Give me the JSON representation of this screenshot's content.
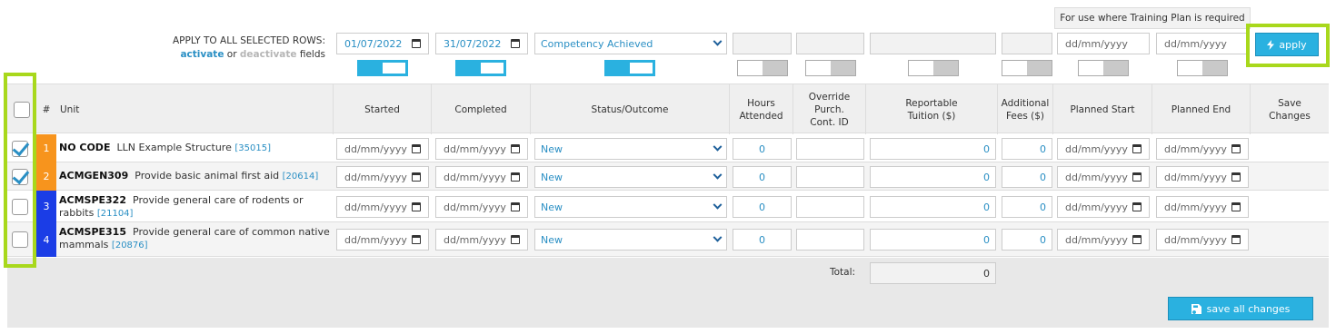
{
  "apply_bar": {
    "instruction": "APPLY TO ALL SELECTED ROWS:",
    "activate": "activate",
    "or": "or",
    "deactivate": "deactivate",
    "fields": "fields",
    "started": "01/07/2022",
    "completed": "31/07/2022",
    "status": "Competency Achieved",
    "planned_start_placeholder": "dd/mm/yyyy",
    "planned_end_placeholder": "dd/mm/yyyy",
    "training_plan_note": "For use where Training Plan is required",
    "apply_label": "apply"
  },
  "columns": {
    "num": "#",
    "unit": "Unit",
    "started": "Started",
    "completed": "Completed",
    "status": "Status/Outcome",
    "hours": "Hours Attended",
    "override": "Override Purch. Cont. ID",
    "tuition": "Reportable Tuition ($)",
    "fees": "Additional Fees ($)",
    "planned_start": "Planned Start",
    "planned_end": "Planned End",
    "save": "Save Changes"
  },
  "rows": [
    {
      "num": "1",
      "code": "NO CODE",
      "title": "LLN Example Structure",
      "id": "35015",
      "checked": true,
      "badge_color": "#f7941d",
      "started": "dd/mm/yyyy",
      "completed": "dd/mm/yyyy",
      "status": "New",
      "hours": "0",
      "tuition": "0",
      "fees": "0",
      "planned_start": "dd/mm/yyyy",
      "planned_end": "dd/mm/yyyy"
    },
    {
      "num": "2",
      "code": "ACMGEN309",
      "title": "Provide basic animal first aid",
      "id": "20614",
      "checked": true,
      "badge_color": "#f7941d",
      "started": "dd/mm/yyyy",
      "completed": "dd/mm/yyyy",
      "status": "New",
      "hours": "0",
      "tuition": "0",
      "fees": "0",
      "planned_start": "dd/mm/yyyy",
      "planned_end": "dd/mm/yyyy"
    },
    {
      "num": "3",
      "code": "ACMSPE322",
      "title": "Provide general care of rodents or rabbits",
      "id": "21104",
      "checked": false,
      "badge_color": "#1b3de6",
      "started": "dd/mm/yyyy",
      "completed": "dd/mm/yyyy",
      "status": "New",
      "hours": "0",
      "tuition": "0",
      "fees": "0",
      "planned_start": "dd/mm/yyyy",
      "planned_end": "dd/mm/yyyy"
    },
    {
      "num": "4",
      "code": "ACMSPE315",
      "title": "Provide general care of common native mammals",
      "id": "20876",
      "checked": false,
      "badge_color": "#1b3de6",
      "started": "dd/mm/yyyy",
      "completed": "dd/mm/yyyy",
      "status": "New",
      "hours": "0",
      "tuition": "0",
      "fees": "0",
      "planned_start": "dd/mm/yyyy",
      "planned_end": "dd/mm/yyyy"
    }
  ],
  "footer": {
    "total_label": "Total:",
    "total_value": "0",
    "save_all_label": "save all changes"
  },
  "colors": {
    "accent": "#2ab1e0",
    "link": "#2a8fc4",
    "highlight": "#a8d81c",
    "orange_badge": "#f7941d",
    "blue_badge": "#1b3de6"
  }
}
